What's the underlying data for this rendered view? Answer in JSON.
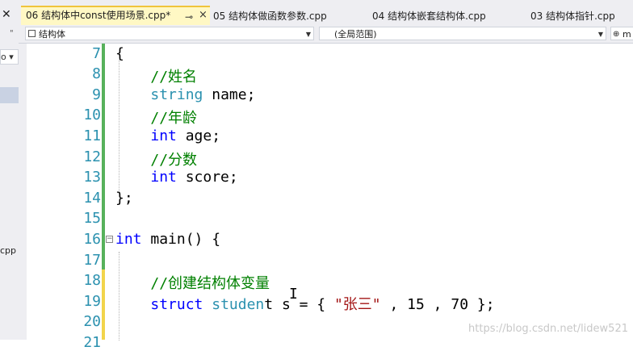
{
  "left_panel": {
    "close_glyph": "✕",
    "pin_glyph": "\"",
    "combo_text": "o ▾",
    "partial_file": "cpp"
  },
  "tabs": [
    {
      "label": "06 结构体中const使用场景.cpp*",
      "active": true,
      "pin": "⊸",
      "close": "×"
    },
    {
      "label": "05 结构体做函数参数.cpp",
      "active": false
    },
    {
      "label": "04 结构体嵌套结构体.cpp",
      "active": false
    },
    {
      "label": "03 结构体指针.cpp",
      "active": false
    }
  ],
  "navbar": {
    "scope_left": "结构体",
    "scope_mid": "(全局范围)",
    "scope_right": "m"
  },
  "lines": [
    {
      "n": "7",
      "code": "{"
    },
    {
      "n": "8",
      "code": "    //姓名"
    },
    {
      "n": "9",
      "code": "    string name;"
    },
    {
      "n": "10",
      "code": "    //年龄"
    },
    {
      "n": "11",
      "code": "    int age;"
    },
    {
      "n": "12",
      "code": "    //分数"
    },
    {
      "n": "13",
      "code": "    int score;"
    },
    {
      "n": "14",
      "code": "};"
    },
    {
      "n": "15",
      "code": ""
    },
    {
      "n": "16",
      "code": "int main() {"
    },
    {
      "n": "17",
      "code": ""
    },
    {
      "n": "18",
      "code": "    //创建结构体变量"
    },
    {
      "n": "19",
      "code": "    struct student s = { \"张三\" , 15 , 70 };"
    },
    {
      "n": "20",
      "code": ""
    },
    {
      "n": "21",
      "code": ""
    }
  ],
  "code_tokens": {
    "l7": "{",
    "l8": "//姓名",
    "l9_type": "string",
    "l9_rest": " name;",
    "l10": "//年龄",
    "l11_kw": "int",
    "l11_rest": " age;",
    "l12": "//分数",
    "l13_kw": "int",
    "l13_rest": " score;",
    "l14": "};",
    "l16_kw": "int",
    "l16_rest": " main() {",
    "l18": "//创建结构体变量",
    "l19_kw": "struct",
    "l19_type": "studen",
    "l19_rest1": "t s = { ",
    "l19_str": "\"张三\"",
    "l19_rest2": " , 15 , 70 };"
  },
  "fold_glyph": "−",
  "watermark": "https://blog.csdn.net/lidew521",
  "colors": {
    "keyword": "#0000ff",
    "type": "#2b91af",
    "comment": "#008000",
    "string": "#a31515",
    "saved_change": "#57b15b",
    "unsaved_change": "#f2d44b",
    "active_tab": "#fff8c4"
  }
}
